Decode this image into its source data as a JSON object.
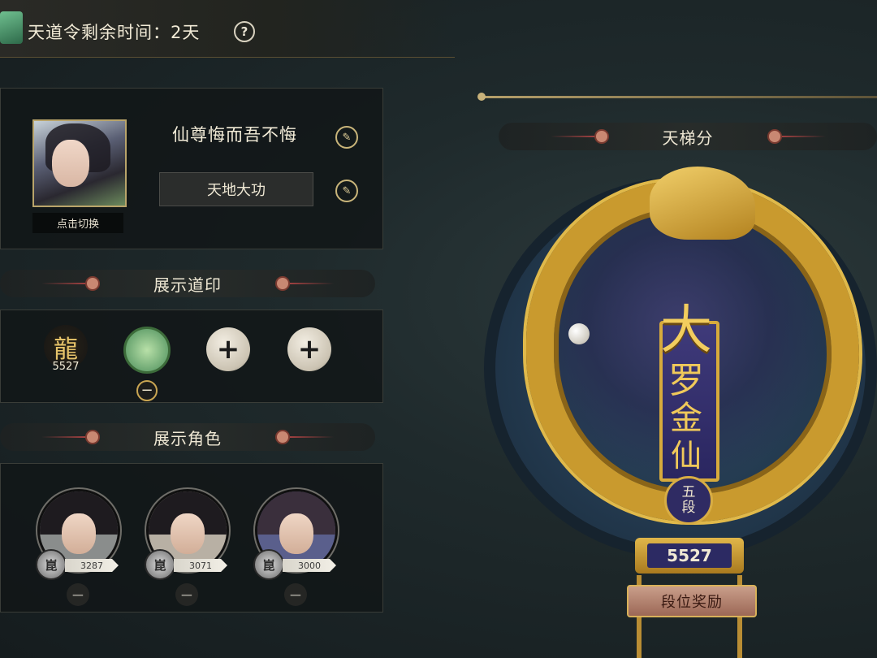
{
  "header": {
    "title": "天道令剩余时间：2天",
    "help_glyph": "?"
  },
  "profile": {
    "switch_label": "点击切换",
    "player_name": "仙尊悔而吾不悔",
    "title": "天地大功",
    "edit_glyph": "✎"
  },
  "seals": {
    "header": "展示道印",
    "items": [
      {
        "type": "dragon-seal",
        "value": "5527"
      },
      {
        "type": "green-seal",
        "remove_glyph": "−"
      },
      {
        "type": "empty",
        "add_glyph": "+"
      },
      {
        "type": "empty",
        "add_glyph": "+"
      }
    ]
  },
  "characters": {
    "header": "展示角色",
    "badge_glyph": "崑",
    "remove_glyph": "−",
    "items": [
      {
        "score": "3287"
      },
      {
        "score": "3071"
      },
      {
        "score": "3000"
      }
    ]
  },
  "ladder": {
    "header": "天梯分",
    "rank_chars": [
      "大",
      "罗",
      "金",
      "仙"
    ],
    "tier_line1": "五",
    "tier_line2": "段",
    "score": "5527",
    "reward_label": "段位奖励"
  },
  "colors": {
    "gold": "#c99a2e",
    "banner": "#2f2b63",
    "accent_red": "#a04040"
  }
}
